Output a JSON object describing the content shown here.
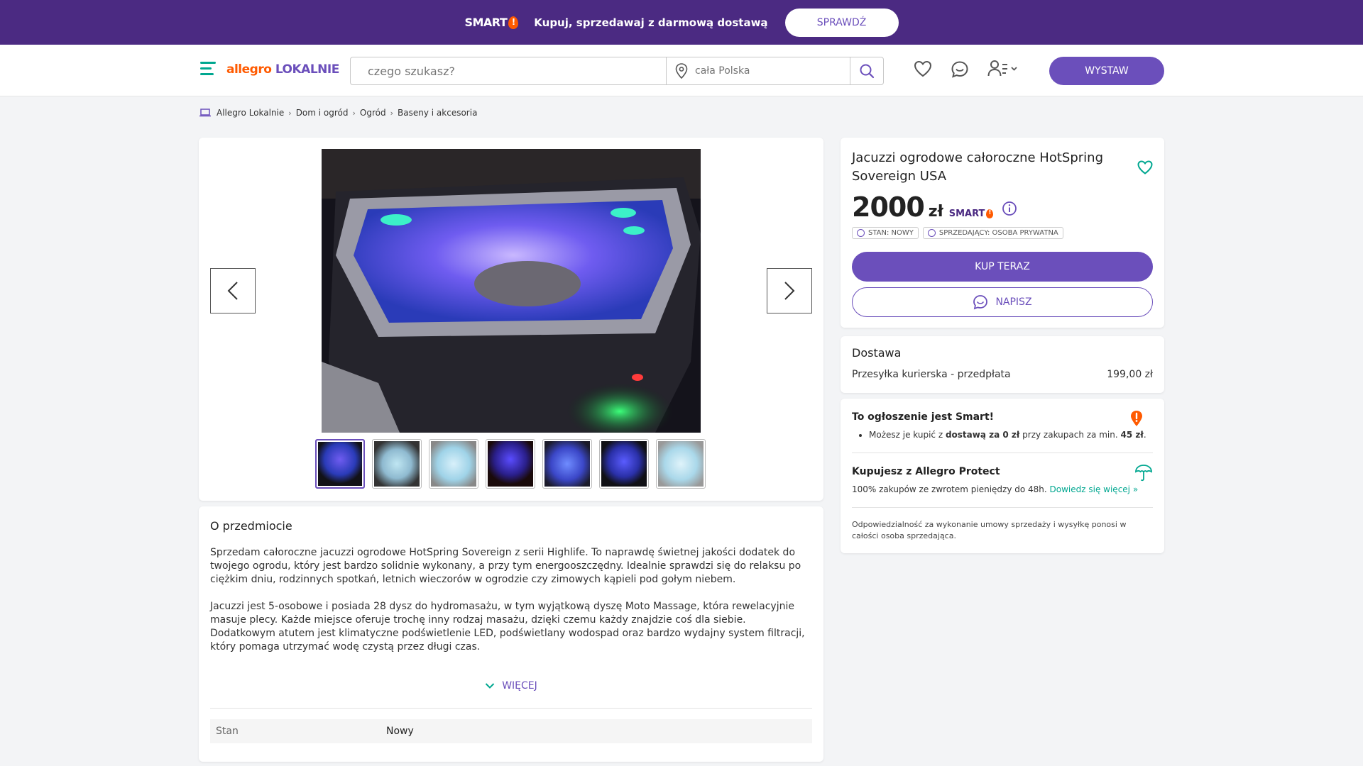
{
  "promo": {
    "smart_label": "SMART",
    "text": "Kupuj, sprzedawaj z darmową dostawą",
    "button": "SPRAWDŹ"
  },
  "header": {
    "logo_part1": "allegro",
    "logo_part2": "LOKALNIE",
    "search_placeholder": "czego szukasz?",
    "location_placeholder": "cała Polska",
    "post_button": "WYSTAW"
  },
  "breadcrumb": [
    "Allegro Lokalnie",
    "Dom i ogród",
    "Ogród",
    "Baseny i akcesoria"
  ],
  "offer": {
    "title": "Jacuzzi ogrodowe całoroczne HotSpring Sovereign USA",
    "price": "2000",
    "currency": "zł",
    "smart_label": "SMART",
    "badge_condition": "STAN: NOWY",
    "badge_seller": "SPRZEDAJĄCY: OSOBA PRYWATNA",
    "buy_button": "KUP TERAZ",
    "write_button": "NAPISZ"
  },
  "delivery": {
    "title": "Dostawa",
    "method": "Przesyłka kurierska - przedpłata",
    "price": "199,00 zł"
  },
  "smart_info": {
    "title": "To ogłoszenie jest Smart!",
    "text_pre": "Możesz je kupić z ",
    "text_bold": "dostawą za 0 zł",
    "text_mid": " przy zakupach za min. ",
    "text_bold2": "45 zł",
    "text_end": ".",
    "protect_title": "Kupujesz z Allegro Protect",
    "protect_text": "100% zakupów ze zwrotem pieniędzy do 48h. ",
    "protect_link": "Dowiedz się więcej »",
    "responsibility": "Odpowiedzialność za wykonanie umowy sprzedaży i wysyłkę ponosi w całości osoba sprzedająca."
  },
  "description": {
    "title": "O przedmiocie",
    "p1": "Sprzedam całoroczne jacuzzi ogrodowe HotSpring Sovereign z serii Highlife. To naprawdę świetnej jakości dodatek do twojego ogrodu, który jest bardzo solidnie wykonany, a przy tym energooszczędny. Idealnie sprawdzi się do relaksu po ciężkim dniu, rodzinnych spotkań, letnich wieczorów w ogrodzie czy zimowych kąpieli pod gołym niebem.",
    "p2": "Jacuzzi jest 5-osobowe i posiada 28 dysz do hydromasażu, w tym wyjątkową dyszę Moto Massage, która rewelacyjnie masuje plecy. Każde miejsce oferuje trochę inny rodzaj masażu, dzięki czemu każdy znajdzie coś dla siebie. Dodatkowym atutem jest klimatyczne podświetlenie LED, podświetlany wodospad oraz bardzo wydajny system filtracji, który pomaga utrzymać wodę czystą przez długi czas.",
    "more_button": "WIĘCEJ",
    "param_label": "Stan",
    "param_value": "Nowy"
  },
  "gallery": {
    "thumb_count": 7,
    "active_thumb": 0
  },
  "colors": {
    "promo_bg": "#4b2a82",
    "accent": "#6b4fbb",
    "brand_orange": "#ff5a00",
    "teal": "#00a790"
  }
}
